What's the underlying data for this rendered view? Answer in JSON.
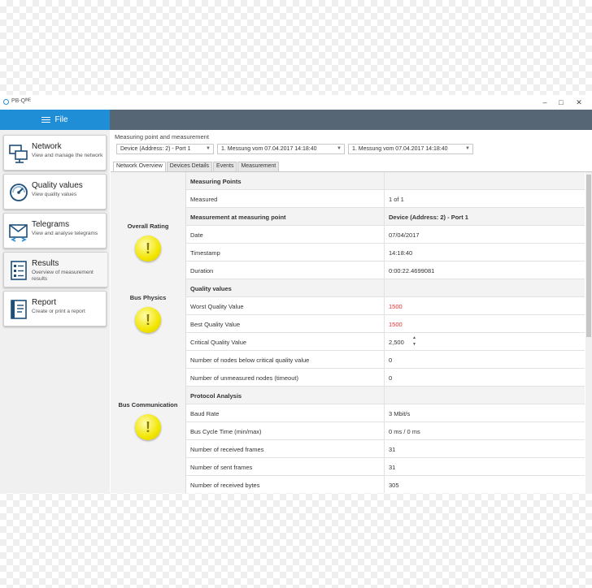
{
  "app": {
    "title": "PB-Qᴵᴺᴱ"
  },
  "window_controls": {
    "minimize": "–",
    "maximize": "□",
    "close": "✕"
  },
  "menu": {
    "file_label": "File"
  },
  "sidebar": {
    "items": [
      {
        "title": "Network",
        "desc": "View and manage the network",
        "icon": "network-icon"
      },
      {
        "title": "Quality values",
        "desc": "View quality values",
        "icon": "gauge-icon"
      },
      {
        "title": "Telegrams",
        "desc": "View and analyse telegrams",
        "icon": "telegram-icon"
      },
      {
        "title": "Results",
        "desc": "Overview of measurement results",
        "icon": "results-icon"
      },
      {
        "title": "Report",
        "desc": "Create or print a report",
        "icon": "report-icon"
      }
    ]
  },
  "measurement": {
    "label": "Measuring point and measurement",
    "selects": [
      "Device (Address: 2) - Port 1",
      "1. Messung vom 07.04.2017 14:18:40",
      "1. Messung vom 07.04.2017 14:18:40"
    ]
  },
  "tabs": [
    "Network Overview",
    "Devices Details",
    "Events",
    "Measurement"
  ],
  "sections": {
    "overall_rating": "Overall Rating",
    "bus_physics": "Bus Physics",
    "bus_communication": "Bus Communication",
    "warning_symbol": "!"
  },
  "table": {
    "rows": [
      {
        "key": "Measuring Points",
        "value": "",
        "head": true
      },
      {
        "key": "Measured",
        "value": "1 of 1"
      },
      {
        "key": "Measurement at measuring point",
        "value": "Device (Address: 2) - Port 1",
        "head": true
      },
      {
        "key": "Date",
        "value": "07/04/2017"
      },
      {
        "key": "Timestamp",
        "value": "14:18:40"
      },
      {
        "key": "Duration",
        "value": "0:00:22.4699081"
      },
      {
        "key": "Quality values",
        "value": "",
        "head": true
      },
      {
        "key": "Worst Quality Value",
        "value": "1500",
        "red": true
      },
      {
        "key": "Best Quality Value",
        "value": "1500",
        "red": true
      },
      {
        "key": "Critical Quality Value",
        "value": "2,500",
        "stepper": true
      },
      {
        "key": "Number of nodes below critical quality value",
        "value": "0"
      },
      {
        "key": "Number of unmeasured nodes (timeout)",
        "value": "0"
      },
      {
        "key": "Protocol Analysis",
        "value": "",
        "head": true
      },
      {
        "key": "Baud Rate",
        "value": "3 Mbit/s"
      },
      {
        "key": "Bus Cycle Time (min/max)",
        "value": "0 ms / 0 ms"
      },
      {
        "key": "Number of received frames",
        "value": "31"
      },
      {
        "key": "Number of sent frames",
        "value": "31"
      },
      {
        "key": "Number of received bytes",
        "value": "305"
      }
    ]
  },
  "colors": {
    "accent": "#1f8ed6",
    "topbar": "#566674",
    "warning": "#f2e600",
    "error_text": "#e03030"
  }
}
